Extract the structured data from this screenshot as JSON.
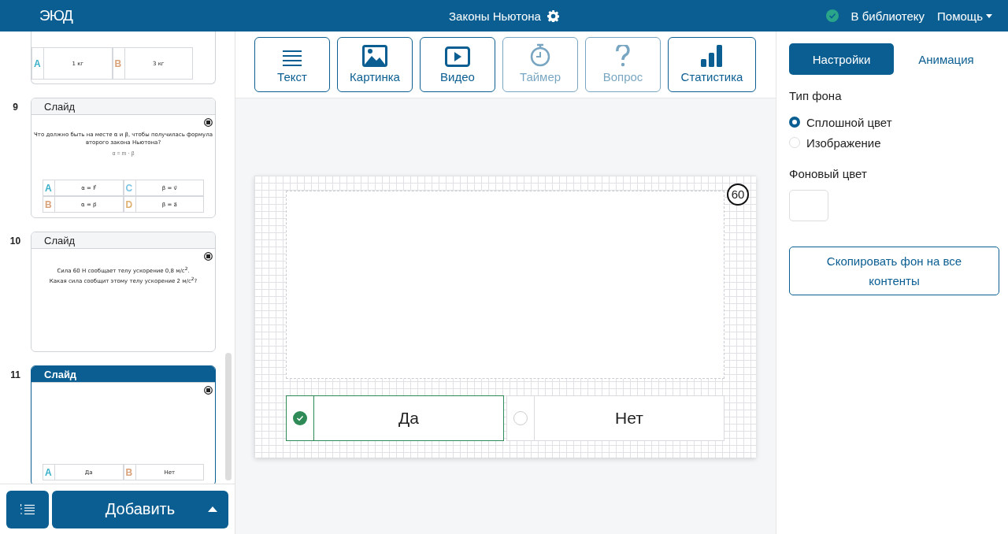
{
  "header": {
    "logo": "ЭЮД",
    "title": "Законы Ньютона",
    "library_link": "В библиотеку",
    "help_menu": "Помощь"
  },
  "slides": [
    {
      "selected": false,
      "answers": [
        {
          "letter": "A",
          "text": "1 кг",
          "color": "#3ab0c8"
        },
        {
          "letter": "B",
          "text": "3 кг",
          "color": "#d9a27a"
        }
      ]
    },
    {
      "number": "9",
      "title": "Слайд",
      "selected": false,
      "question": [
        "Что должно быть на месте α и β, чтобы получилась формула",
        "второго закона Ньютона?"
      ],
      "formula": "α = m · β",
      "answers": [
        {
          "letter": "A",
          "text": "α = F⃗",
          "color": "#3ab0c8"
        },
        {
          "letter": "C",
          "text": "β = v⃗",
          "color": "#7cc4e4"
        },
        {
          "letter": "B",
          "text": "α = p⃗",
          "color": "#d9a27a"
        },
        {
          "letter": "D",
          "text": "β = a⃗",
          "color": "#e0b070"
        }
      ]
    },
    {
      "number": "10",
      "title": "Слайд",
      "selected": false,
      "question": [
        "Сила 60 Н сообщает телу ускорение 0,8 м/с$^{2}$.",
        "Какая сила сообщит этому телу ускорение 2 м/с$^{2}$?"
      ]
    },
    {
      "number": "11",
      "title": "Слайд",
      "selected": true,
      "answers": [
        {
          "letter": "A",
          "text": "Да",
          "color": "#3ab0c8"
        },
        {
          "letter": "B",
          "text": "Нет",
          "color": "#d9a27a"
        }
      ]
    }
  ],
  "add_button": "Добавить",
  "tools": [
    {
      "label": "Текст",
      "disabled": false
    },
    {
      "label": "Картинка",
      "disabled": false
    },
    {
      "label": "Видео",
      "disabled": false
    },
    {
      "label": "Таймер",
      "disabled": true
    },
    {
      "label": "Вопрос",
      "disabled": true
    },
    {
      "label": "Статистика",
      "disabled": false
    }
  ],
  "canvas": {
    "timer": "60",
    "answers": [
      {
        "text": "Да",
        "correct": true
      },
      {
        "text": "Нет",
        "correct": false
      }
    ]
  },
  "settings": {
    "tabs": [
      {
        "label": "Настройки",
        "selected": true
      },
      {
        "label": "Анимация",
        "selected": false
      }
    ],
    "background_type_label": "Тип фона",
    "background_types": [
      {
        "label": "Сплошной цвет",
        "selected": true
      },
      {
        "label": "Изображение",
        "selected": false
      }
    ],
    "color_label": "Фоновый цвет",
    "copy_button": "Скопировать фон на все контенты"
  }
}
